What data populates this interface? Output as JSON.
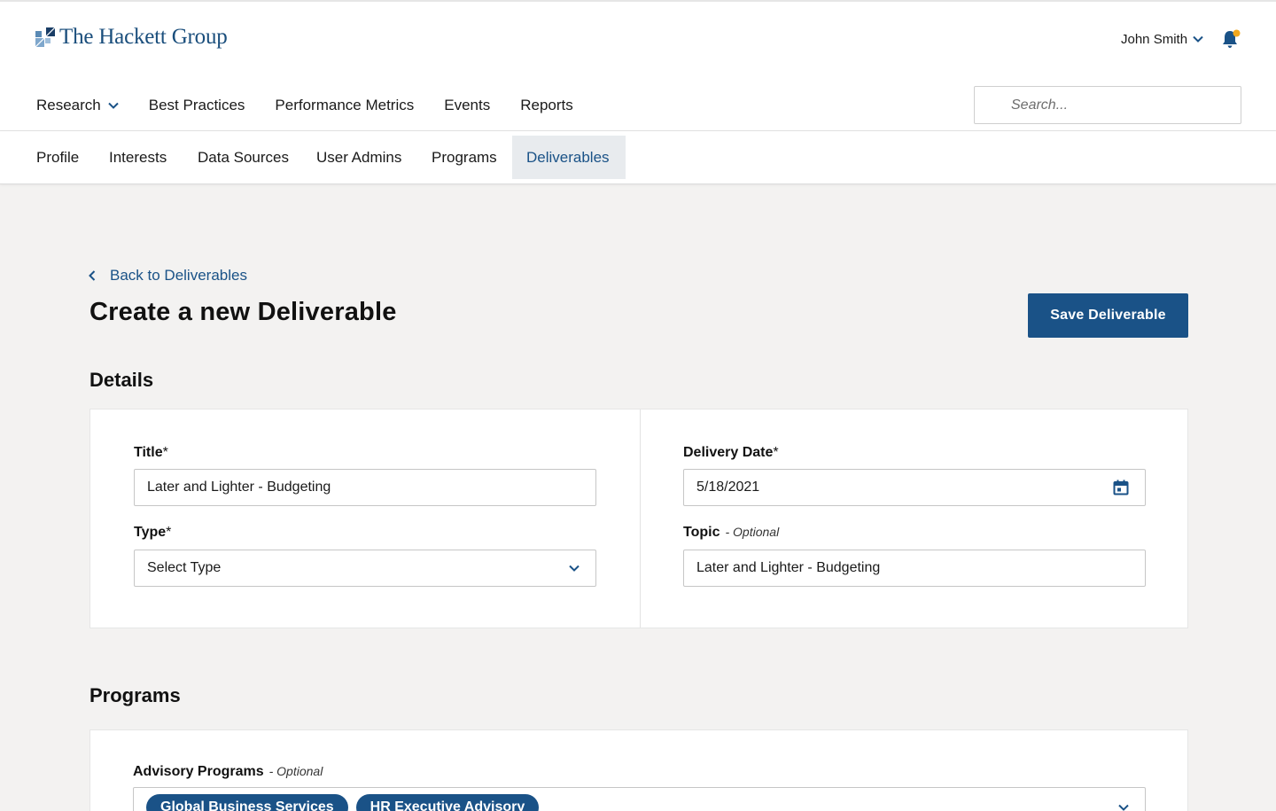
{
  "brand": {
    "name": "The Hackett Group",
    "color": "#1a4e7c",
    "accent": "#1a5287",
    "notify_dot": "#f2a81d"
  },
  "header": {
    "user_name": "John Smith",
    "search_placeholder": "Search...",
    "nav": [
      {
        "label": "Research",
        "has_dropdown": true
      },
      {
        "label": "Best Practices"
      },
      {
        "label": "Performance Metrics"
      },
      {
        "label": "Events"
      },
      {
        "label": "Reports"
      }
    ]
  },
  "subnav": {
    "tabs": [
      {
        "label": "Profile"
      },
      {
        "label": "Interests"
      },
      {
        "label": "Data Sources"
      },
      {
        "label": "User Admins"
      },
      {
        "label": "Programs"
      },
      {
        "label": "Deliverables",
        "active": true
      }
    ]
  },
  "page": {
    "back_label": "Back to Deliverables",
    "title": "Create a new Deliverable",
    "save_label": "Save Deliverable"
  },
  "details": {
    "heading": "Details",
    "title_label": "Title",
    "title_required": "*",
    "title_value": "Later and Lighter - Budgeting",
    "type_label": "Type",
    "type_required": "*",
    "type_value": "Select Type",
    "date_label": "Delivery Date",
    "date_required": "*",
    "date_value": "5/18/2021",
    "topic_label": "Topic",
    "topic_optional": "- Optional",
    "topic_value": "Later and Lighter - Budgeting"
  },
  "programs": {
    "heading": "Programs",
    "advisory_label": "Advisory Programs",
    "advisory_optional": "- Optional",
    "selected": [
      "Global Business Services",
      "HR Executive Advisory"
    ]
  }
}
